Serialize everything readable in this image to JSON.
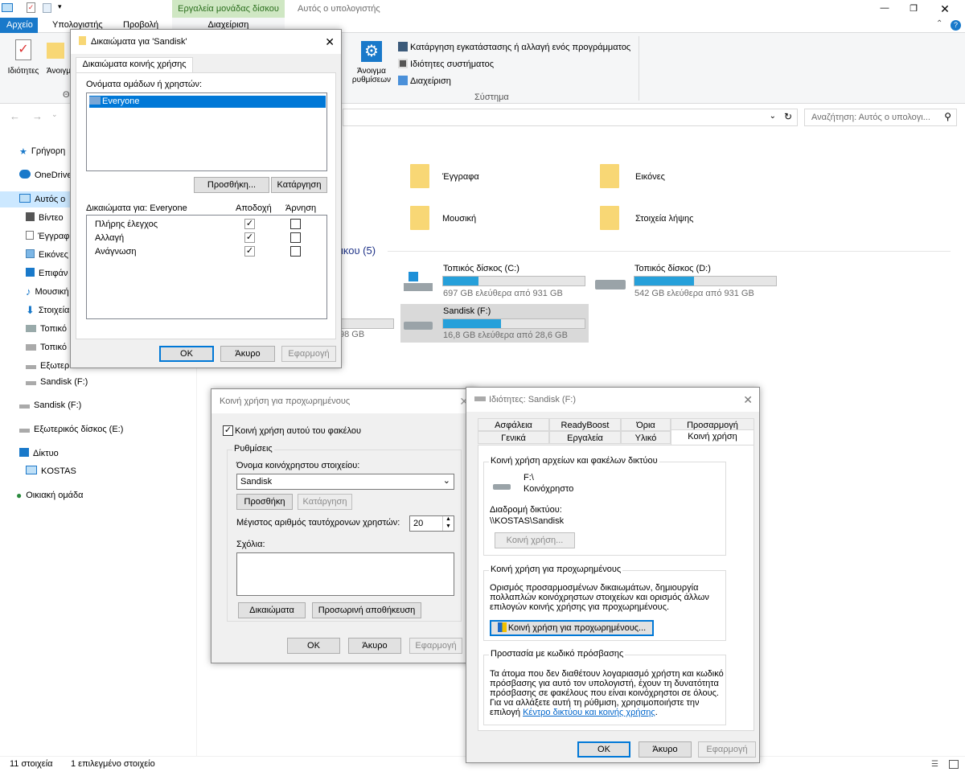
{
  "window": {
    "contextual_tab": "Εργαλεία μονάδας δίσκου",
    "title": "Αυτός ο υπολογιστής"
  },
  "tabs": {
    "file": "Αρχείο",
    "computer": "Υπολογιστής",
    "view": "Προβολή",
    "manage": "Διαχείριση"
  },
  "ribbon": {
    "properties": "Ιδιότητες",
    "open": "Άνοιγμ",
    "open_settings_1": "Άνοιγμα",
    "open_settings_2": "ρυθμίσεων",
    "uninstall": "Κατάργηση εγκατάστασης ή αλλαγή ενός προγράμματος",
    "system_properties": "Ιδιότητες συστήματος",
    "manage": "Διαχείριση",
    "group_system": "Σύστημα",
    "group_loc": "Θέ"
  },
  "search": {
    "placeholder": "Αναζήτηση: Αυτός ο υπολογι..."
  },
  "nav": {
    "quick": "Γρήγορη",
    "onedrive": "OneDrive",
    "thispc": "Αυτός ο",
    "video": "Βίντεο",
    "docs": "Έγγραφ",
    "pics": "Εικόνες",
    "desktop": "Επιφάν",
    "music": "Μουσική",
    "downloads": "Στοιχεία",
    "local1": "Τοπικό",
    "local2": "Τοπικό",
    "external1": "Εξωτερ",
    "sandisk1": "Sandisk (F:)",
    "sandisk2": "Sandisk (F:)",
    "external2": "Εξωτερικός δίσκος (E:)",
    "network": "Δίκτυο",
    "kostas": "KOSTAS",
    "homegroup": "Οικιακή ομάδα"
  },
  "content": {
    "folders": [
      "Έγγραφα",
      "Εικόνες",
      "Μουσική",
      "Στοιχεία λήψης"
    ],
    "devices_header": "ικου (5)",
    "partial_drive": "98 GB",
    "drives": [
      {
        "name": "Τοπικός δίσκος (C:)",
        "free": "697 GB ελεύθερα από 931 GB",
        "used_fraction": 0.25
      },
      {
        "name": "Τοπικός δίσκος (D:)",
        "free": "542 GB ελεύθερα από 931 GB",
        "used_fraction": 0.42
      },
      {
        "name": "Sandisk (F:)",
        "free": "16,8 GB ελεύθερα από 28,6 GB",
        "used_fraction": 0.41
      }
    ]
  },
  "status": {
    "count": "11 στοιχεία",
    "selected": "1 επιλεγμένο στοιχείο"
  },
  "perm_dialog": {
    "title": "Δικαιώματα για 'Sandisk'",
    "tab": "Δικαιώματα κοινής χρήσης",
    "users_label": "Ονόματα ομάδων ή χρηστών:",
    "user": "Everyone",
    "add": "Προσθήκη...",
    "remove": "Κατάργηση",
    "perms_for": "Δικαιώματα για: Everyone",
    "allow": "Αποδοχή",
    "deny": "Άρνηση",
    "perms": [
      {
        "name": "Πλήρης έλεγχος",
        "allow": true,
        "deny": false
      },
      {
        "name": "Αλλαγή",
        "allow": true,
        "deny": false
      },
      {
        "name": "Ανάγνωση",
        "allow": true,
        "deny": false
      }
    ],
    "ok": "OK",
    "cancel": "Άκυρο",
    "apply": "Εφαρμογή"
  },
  "adv_dialog": {
    "title": "Κοινή χρήση για προχωρημένους",
    "share_check": "Κοινή χρήση αυτού του φακέλου",
    "settings": "Ρυθμίσεις",
    "share_name_label": "Όνομα κοινόχρηστου στοιχείου:",
    "share_name": "Sandisk",
    "add": "Προσθήκη",
    "remove": "Κατάργηση",
    "max_users_label": "Μέγιστος αριθμός ταυτόχρονων χρηστών:",
    "max_users": "20",
    "comments": "Σχόλια:",
    "permissions": "Δικαιώματα",
    "caching": "Προσωρινή αποθήκευση",
    "ok": "OK",
    "cancel": "Άκυρο",
    "apply": "Εφαρμογή"
  },
  "props_dialog": {
    "title": "Ιδιότητες: Sandisk (F:)",
    "tabs_row1": [
      "Ασφάλεια",
      "ReadyBoost",
      "Όρια",
      "Προσαρμογή"
    ],
    "tabs_row2": [
      "Γενικά",
      "Εργαλεία",
      "Υλικό",
      "Κοινή χρήση"
    ],
    "net_group": "Κοινή χρήση αρχείων και φακέλων δικτύου",
    "path_short": "F:\\",
    "shared": "Κοινόχρηστο",
    "net_path_label": "Διαδρομή δικτύου:",
    "net_path": "\\\\KOSTAS\\Sandisk",
    "share_btn": "Κοινή χρήση...",
    "adv_group": "Κοινή χρήση για προχωρημένους",
    "adv_desc1": "Ορισμός προσαρμοσμένων δικαιωμάτων, δημιουργία",
    "adv_desc2": "πολλαπλών κοινόχρηστων στοιχείων και ορισμός άλλων",
    "adv_desc3": "επιλογών κοινής χρήσης για προχωρημένους.",
    "adv_btn": "Κοινή χρήση για προχωρημένους...",
    "pwd_group": "Προστασία με κωδικό πρόσβασης",
    "pwd_desc1": "Τα άτομα που δεν διαθέτουν λογαριασμό χρήστη και κωδικό",
    "pwd_desc2": "πρόσβασης για αυτό τον υπολογιστή, έχουν τη δυνατότητα",
    "pwd_desc3": "πρόσβασης σε φακέλους που είναι κοινόχρηστοι σε όλους.",
    "pwd_desc4": "Για να αλλάξετε αυτή τη ρύθμιση, χρησιμοποιήστε την",
    "pwd_desc5": "επιλογή",
    "pwd_link": "Κέντρο δικτύου και κοινής χρήσης",
    "ok": "OK",
    "cancel": "Άκυρο",
    "apply": "Εφαρμογή"
  },
  "colors": {
    "accent": "#0078d7",
    "selection": "#0078d7",
    "drive_bar": "#26a0da",
    "folder": "#f8d775"
  }
}
